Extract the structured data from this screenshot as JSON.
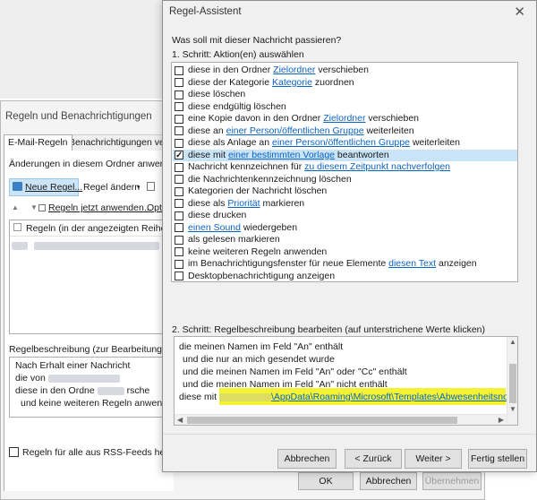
{
  "background_window": {
    "title": "Regeln und Benachrichtigungen",
    "tabs": [
      "E-Mail-Regeln",
      "Benachrichtigungen verw"
    ],
    "changes_label": "Änderungen in diesem Ordner anwende",
    "toolbar": {
      "new_rule": "Neue Regel...",
      "change_rule": "Regel ändern",
      "copy_icon": "copy-icon"
    },
    "apply_now": "Regeln jetzt anwenden...",
    "options": "Opti",
    "list_header": "Regeln (in der angezeigten Reihen",
    "rule_desc_label": "Regelbeschreibung (zur Bearbeitung au",
    "desc_lines": [
      "Nach Erhalt einer Nachricht",
      "die von",
      "diese in den Ordne",
      "rsche",
      "und keine weiteren Regeln anwende"
    ],
    "rss_label": "Regeln für alle aus RSS-Feeds herunt",
    "ok": "OK",
    "cancel": "Abbrechen",
    "apply": "Übernehmen"
  },
  "dialog": {
    "title": "Regel-Assistent",
    "question": "Was soll mit dieser Nachricht passieren?",
    "step1": "1. Schritt: Aktion(en) auswählen",
    "step2": "2. Schritt: Regelbeschreibung bearbeiten (auf unterstrichene Werte klicken)",
    "actions": [
      {
        "checked": false,
        "parts": [
          {
            "t": "diese in den Ordner "
          },
          {
            "t": "Zielordner",
            "link": true
          },
          {
            "t": " verschieben"
          }
        ]
      },
      {
        "checked": false,
        "parts": [
          {
            "t": "diese der Kategorie "
          },
          {
            "t": "Kategorie",
            "link": true
          },
          {
            "t": " zuordnen"
          }
        ]
      },
      {
        "checked": false,
        "parts": [
          {
            "t": "diese löschen"
          }
        ]
      },
      {
        "checked": false,
        "parts": [
          {
            "t": "diese endgültig löschen"
          }
        ]
      },
      {
        "checked": false,
        "parts": [
          {
            "t": "eine Kopie davon in den Ordner "
          },
          {
            "t": "Zielordner",
            "link": true
          },
          {
            "t": " verschieben"
          }
        ]
      },
      {
        "checked": false,
        "parts": [
          {
            "t": "diese an "
          },
          {
            "t": "einer Person/öffentlichen Gruppe",
            "link": true
          },
          {
            "t": " weiterleiten"
          }
        ]
      },
      {
        "checked": false,
        "parts": [
          {
            "t": "diese als Anlage an "
          },
          {
            "t": "einer Person/öffentlichen Gruppe",
            "link": true
          },
          {
            "t": " weiterleiten"
          }
        ]
      },
      {
        "checked": true,
        "selected": true,
        "parts": [
          {
            "t": "diese mit "
          },
          {
            "t": "einer bestimmten Vorlage",
            "link": true
          },
          {
            "t": " beantworten"
          }
        ]
      },
      {
        "checked": false,
        "parts": [
          {
            "t": "Nachricht kennzeichnen für "
          },
          {
            "t": "zu diesem Zeitpunkt nachverfolgen",
            "link": true
          }
        ]
      },
      {
        "checked": false,
        "parts": [
          {
            "t": "die Nachrichtenkennzeichnung löschen"
          }
        ]
      },
      {
        "checked": false,
        "parts": [
          {
            "t": "Kategorien der Nachricht löschen"
          }
        ]
      },
      {
        "checked": false,
        "parts": [
          {
            "t": "diese als "
          },
          {
            "t": "Priorität",
            "link": true
          },
          {
            "t": " markieren"
          }
        ]
      },
      {
        "checked": false,
        "parts": [
          {
            "t": "diese drucken"
          }
        ]
      },
      {
        "checked": false,
        "parts": [
          {
            "t": "einen Sound",
            "link": true
          },
          {
            "t": " wiedergeben"
          }
        ]
      },
      {
        "checked": false,
        "parts": [
          {
            "t": "als gelesen markieren"
          }
        ]
      },
      {
        "checked": false,
        "parts": [
          {
            "t": "keine weiteren Regeln anwenden"
          }
        ]
      },
      {
        "checked": false,
        "parts": [
          {
            "t": "im Benachrichtigungsfenster für neue Elemente "
          },
          {
            "t": "diesen Text",
            "link": true
          },
          {
            "t": " anzeigen"
          }
        ]
      },
      {
        "checked": false,
        "parts": [
          {
            "t": "Desktopbenachrichtigung anzeigen"
          }
        ]
      }
    ],
    "description": {
      "line1": "die meinen Namen im Feld \"An\" enthält",
      "line2": "und die nur an mich gesendet wurde",
      "line3": "und die meinen Namen im Feld \"An\" oder \"Cc\" enthält",
      "line4": "und die meinen Namen im Feld \"An\" nicht enthält",
      "line5_prefix": "diese mit",
      "line5_link": "\\AppData\\Roaming\\Microsoft\\Templates\\Abwesenheitsnot"
    },
    "buttons": {
      "cancel": "Abbrechen",
      "back": "< Zurück",
      "next": "Weiter >",
      "finish": "Fertig stellen"
    },
    "colors": {
      "highlight": "#f2f21e",
      "selected_row": "#c9e3f7",
      "link": "#0b64c0"
    }
  }
}
